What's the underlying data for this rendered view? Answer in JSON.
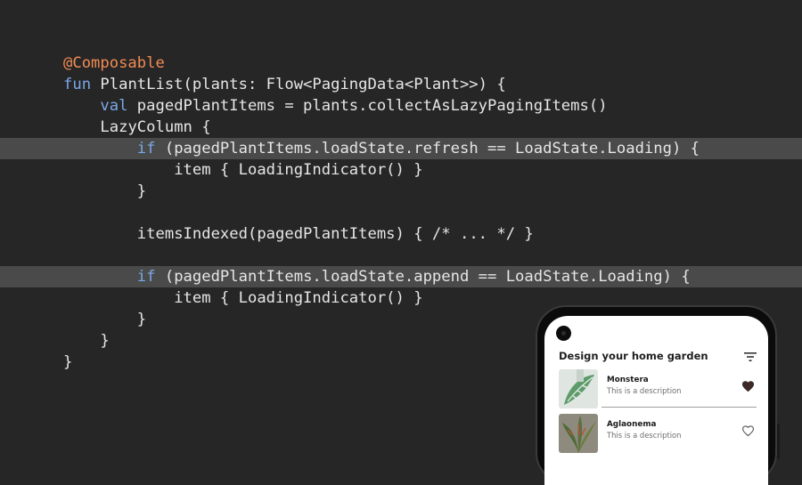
{
  "code": {
    "annotation": "@Composable",
    "kw_fun": "fun",
    "kw_val": "val",
    "kw_if": "if",
    "fn_signature_start": " PlantList",
    "fn_params": "(plants: Flow<PagingData<Plant>>) {",
    "paged_decl": " pagedPlantItems = plants.collectAsLazyPagingItems()",
    "lazy_column": "LazyColumn {",
    "refresh_cond": " (pagedPlantItems.loadState.refresh == LoadState.Loading) {",
    "item_loading": "item { LoadingIndicator() }",
    "close_brace": "}",
    "items_indexed": "itemsIndexed(pagedPlantItems) { /* ... */ }",
    "append_cond": " (pagedPlantItems.loadState.append == LoadState.Loading) {"
  },
  "phone": {
    "app_title": "Design your home garden",
    "plants": [
      {
        "name": "Monstera",
        "description": "This is a description",
        "favorite": true
      },
      {
        "name": "Aglaonema",
        "description": "This is a description",
        "favorite": false
      }
    ]
  },
  "colors": {
    "background": "#262626",
    "highlight": "#4a4a4a",
    "annotation": "#f28b54",
    "keyword": "#7ba8e6",
    "text": "#e6e6e6"
  }
}
